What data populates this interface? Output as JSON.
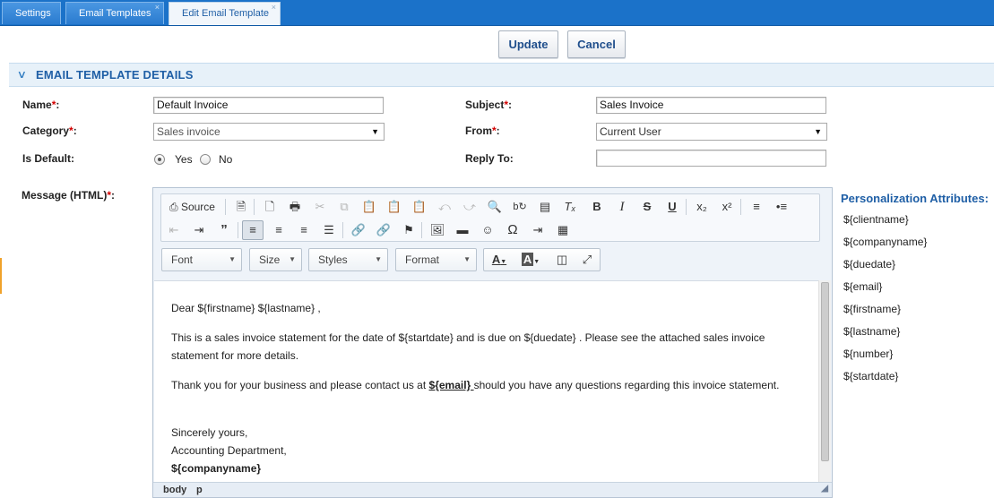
{
  "tabs": [
    {
      "label": "Settings",
      "closable": false
    },
    {
      "label": "Email Templates",
      "closable": true
    },
    {
      "label": "Edit Email Template",
      "closable": true,
      "active": true
    }
  ],
  "close_glyph": "×",
  "actions": {
    "update_label": "Update",
    "cancel_label": "Cancel"
  },
  "section": {
    "title": "EMAIL TEMPLATE DETAILS"
  },
  "form": {
    "name_label": "Name",
    "name_value": "Default Invoice",
    "subject_label": "Subject",
    "subject_value": "Sales Invoice",
    "category_label": "Category",
    "category_value": "Sales invoice",
    "from_label": "From",
    "from_value": "Current User",
    "is_default_label": "Is Default:",
    "yes_label": "Yes",
    "no_label": "No",
    "is_default_value": "Yes",
    "reply_to_label": "Reply To:",
    "reply_to_value": "",
    "message_label": "Message (HTML)",
    "required_mark": "*",
    "colon": ":"
  },
  "editor": {
    "source_label": "Source",
    "font_label": "Font",
    "size_label": "Size",
    "styles_label": "Styles",
    "format_label": "Format",
    "status_path": [
      "body",
      "p"
    ],
    "content": {
      "greeting": "Dear ${firstname} ${lastname} ,",
      "para1": "This is a sales invoice statement for the date of ${startdate} and is due on ${duedate} . Please see the attached sales invoice statement for more details.",
      "para2_before": "Thank you for your business and please contact us at ",
      "para2_email": "${email} ",
      "para2_after": "should you have any questions regarding this invoice statement.",
      "closing": "Sincerely yours,",
      "department": "Accounting Department,",
      "company": "${companyname}"
    }
  },
  "personalization": {
    "title": "Personalization Attributes:",
    "items": [
      "${clientname}",
      "${companyname}",
      "${duedate}",
      "${email}",
      "${firstname}",
      "${lastname}",
      "${number}",
      "${startdate}"
    ]
  },
  "colors": {
    "tabbar": "#1b72c9",
    "accent": "#1f5fa6",
    "required": "#d20000"
  }
}
